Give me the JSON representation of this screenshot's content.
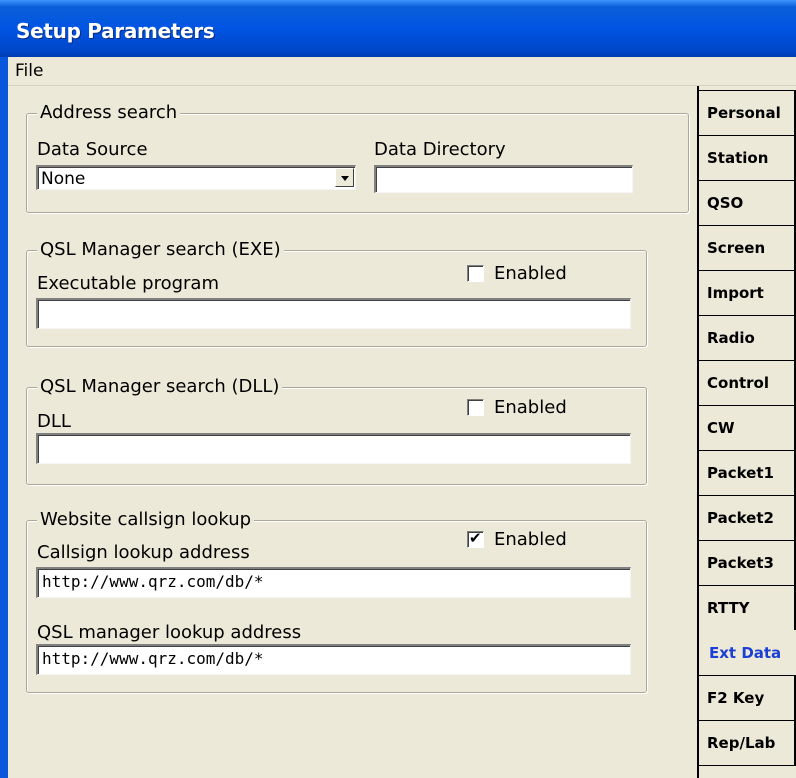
{
  "window": {
    "title": "Setup Parameters"
  },
  "menu": {
    "file": "File"
  },
  "address_search": {
    "legend": "Address search",
    "data_source_label": "Data Source",
    "data_source_value": "None",
    "data_directory_label": "Data Directory",
    "data_directory_value": ""
  },
  "qsl_exe": {
    "legend": "QSL Manager search (EXE)",
    "program_label": "Executable program",
    "enabled_label": "Enabled",
    "enabled": false,
    "program_value": ""
  },
  "qsl_dll": {
    "legend": "QSL Manager search (DLL)",
    "dll_label": "DLL",
    "enabled_label": "Enabled",
    "enabled": false,
    "dll_value": ""
  },
  "website": {
    "legend": "Website callsign lookup",
    "enabled_label": "Enabled",
    "enabled": true,
    "callsign_label": "Callsign lookup address",
    "callsign_value": "http://www.qrz.com/db/*",
    "qsl_label": "QSL manager lookup address",
    "qsl_value": "http://www.qrz.com/db/*"
  },
  "tabs": [
    {
      "label": "Personal"
    },
    {
      "label": "Station"
    },
    {
      "label": "QSO"
    },
    {
      "label": "Screen"
    },
    {
      "label": "Import"
    },
    {
      "label": "Radio"
    },
    {
      "label": "Control"
    },
    {
      "label": "CW"
    },
    {
      "label": "Packet1"
    },
    {
      "label": "Packet2"
    },
    {
      "label": "Packet3"
    },
    {
      "label": "RTTY"
    },
    {
      "label": "Ext Data",
      "active": true
    },
    {
      "label": "F2 Key"
    },
    {
      "label": "Rep/Lab"
    }
  ],
  "colors": {
    "active_tab_text": "#1c3fd6",
    "titlebar": "#0054e3",
    "face": "#ece9d8"
  }
}
